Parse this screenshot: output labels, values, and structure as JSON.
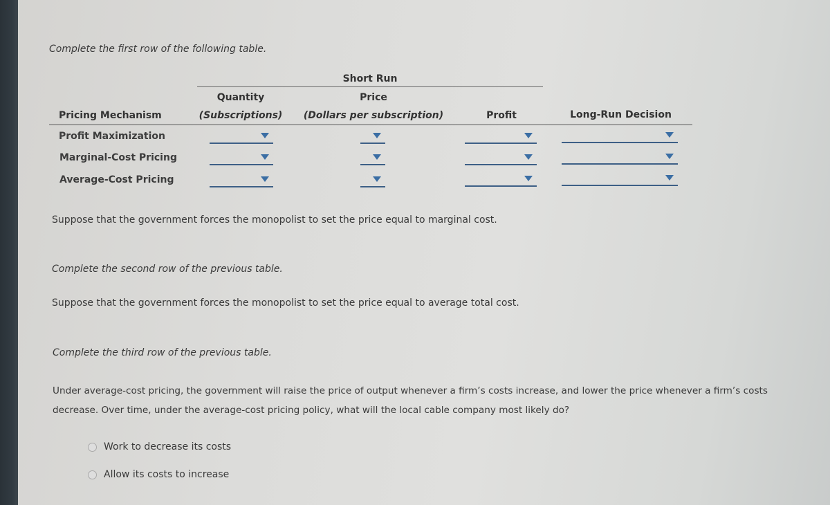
{
  "instructions": {
    "first_row": "Complete the first row of the following table.",
    "second_row": "Complete the second row of the previous table.",
    "third_row": "Complete the third row of the previous table."
  },
  "table": {
    "group_header": "Short Run",
    "columns": {
      "mechanism": "Pricing Mechanism",
      "quantity_title": "Quantity",
      "quantity_unit": "(Subscriptions)",
      "price_title": "Price",
      "price_unit": "(Dollars per subscription)",
      "profit": "Profit",
      "long_run": "Long-Run Decision"
    },
    "rows": [
      {
        "label": "Profit Maximization",
        "quantity": "",
        "price": "",
        "profit": "",
        "long_run": ""
      },
      {
        "label": "Marginal-Cost Pricing",
        "quantity": "",
        "price": "",
        "profit": "",
        "long_run": ""
      },
      {
        "label": "Average-Cost Pricing",
        "quantity": "",
        "price": "",
        "profit": "",
        "long_run": ""
      }
    ]
  },
  "scenarios": {
    "marginal_cost": "Suppose that the government forces the monopolist to set the price equal to marginal cost.",
    "average_cost": "Suppose that the government forces the monopolist to set the price equal to average total cost."
  },
  "question": {
    "line1": "Under average-cost pricing, the government will raise the price of output whenever a firm’s costs increase, and lower the price whenever a firm’s costs",
    "line2": "decrease. Over time, under the average-cost pricing policy, what will the local cable company most likely do?",
    "options": [
      {
        "label": "Work to decrease its costs",
        "selected": false
      },
      {
        "label": "Allow its costs to increase",
        "selected": false
      }
    ]
  },
  "icons": {
    "dropdown": "chevron-down-icon",
    "radio": "radio-unchecked-icon"
  },
  "colors": {
    "dropdown_accent": "#3b6ea4",
    "dropdown_line": "#3d5f86"
  }
}
